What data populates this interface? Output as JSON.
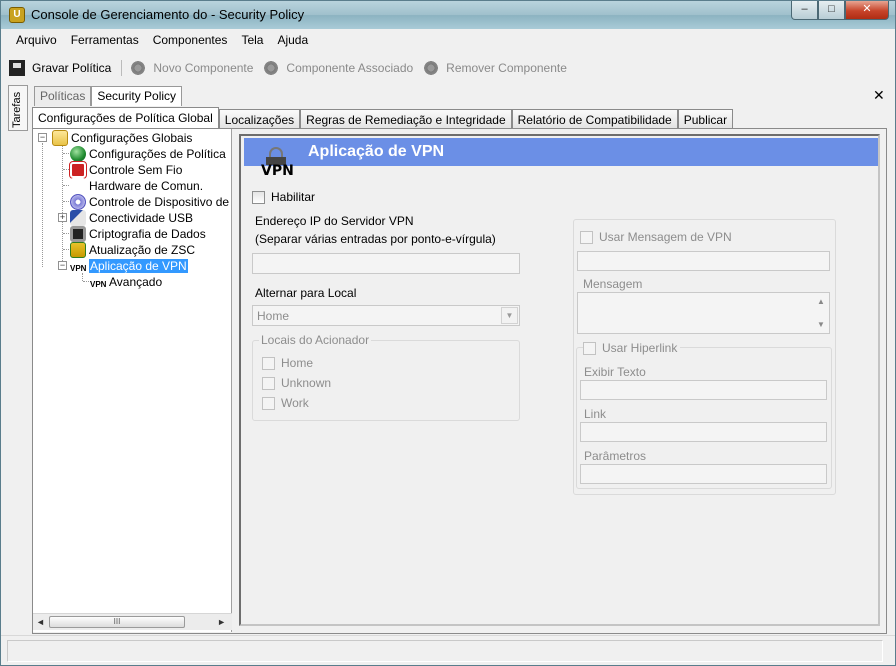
{
  "window": {
    "title": "Console de Gerenciamento do  - Security Policy",
    "buttons": {
      "minimize": "–",
      "maximize": "□",
      "close": "✕"
    }
  },
  "menu": [
    "Arquivo",
    "Ferramentas",
    "Componentes",
    "Tela",
    "Ajuda"
  ],
  "toolbar": {
    "save": "Gravar Política",
    "new_component": "Novo Componente",
    "assoc_component": "Componente Associado",
    "remove_component": "Remover Componente"
  },
  "side_strip": "Tarefas",
  "doc_tabs": [
    "Políticas",
    "Security Policy"
  ],
  "close_glyph": "✕",
  "sub_tabs": [
    "Configurações de Política Global",
    "Localizações",
    "Regras de Remediação e Integridade",
    "Relatório de Compatibilidade",
    "Publicar"
  ],
  "tree": {
    "root": "Configurações Globais",
    "items": [
      "Configurações de Política",
      "Controle Sem Fio",
      "Hardware de Comun.",
      "Controle de Dispositivo de",
      "Conectividade USB",
      "Criptografia de Dados",
      "Atualização de ZSC",
      "Aplicação de VPN"
    ],
    "child": "Avançado",
    "expander_minus": "−",
    "expander_plus": "+"
  },
  "scroll": {
    "left": "◄",
    "right": "►",
    "thumb": "III"
  },
  "detail": {
    "header_title": "Aplicação de VPN",
    "icon_text": "VPN",
    "habilitar": "Habilitar",
    "server_label": "Endereço IP do Servidor VPN",
    "server_hint": "(Separar várias entradas por ponto-e-vírgula)",
    "server_value": "",
    "switch_label": "Alternar para Local",
    "switch_value": "Home",
    "triggers_title": "Locais do Acionador",
    "triggers": [
      "Home",
      "Unknown",
      "Work"
    ],
    "use_vpn_message": "Usar Mensagem de VPN",
    "message_label": "Mensagem",
    "use_hyperlink": "Usar Hiperlink",
    "display_text_label": "Exibir Texto",
    "link_label": "Link",
    "params_label": "Parâmetros",
    "arrow_up": "▲",
    "arrow_down": "▼"
  },
  "colors": {
    "header_blue": "#6b8fe6",
    "selection": "#3399ff"
  }
}
